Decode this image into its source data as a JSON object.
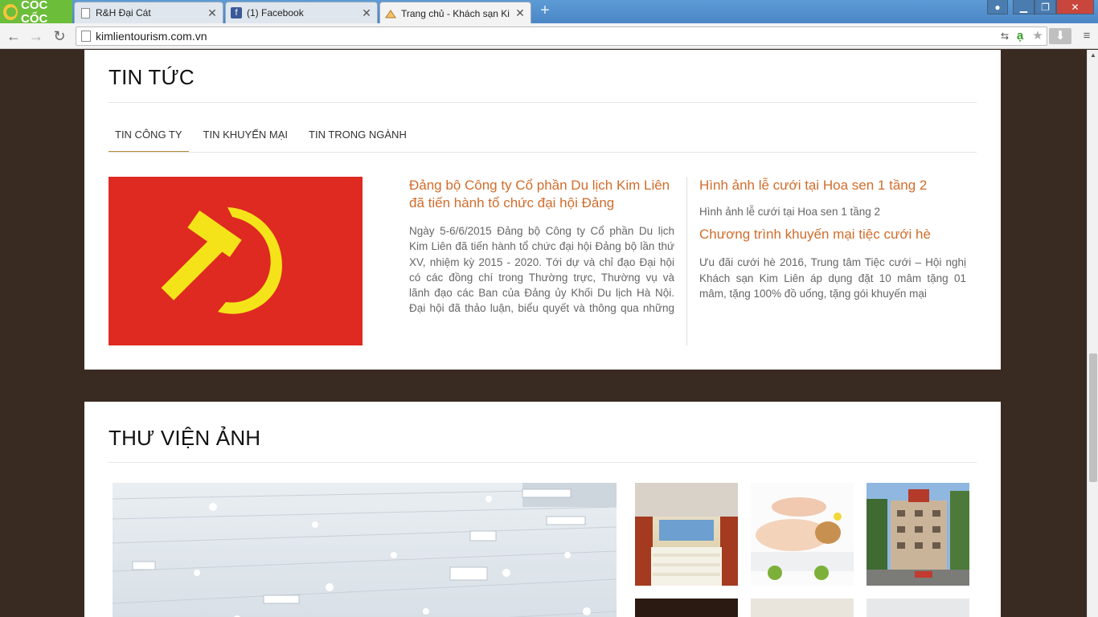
{
  "browser": {
    "brand": "CỐC CỐC",
    "tabs": [
      {
        "title": "R&H Đại Cát",
        "icon": "page-icon"
      },
      {
        "title": "(1) Facebook",
        "icon": "facebook-icon"
      },
      {
        "title": "Trang chủ - Khách sạn Kim",
        "icon": "hotel-favicon"
      }
    ],
    "url": "kimlientourism.com.vn"
  },
  "news": {
    "heading": "TIN TỨC",
    "tabs": [
      "TIN CÔNG TY",
      "TIN KHUYẾN MẠI",
      "TIN TRONG NGÀNH"
    ],
    "active_tab": "TIN CÔNG TY",
    "featured": {
      "title": "Đảng bộ Công ty Cổ phần Du lịch Kim Liên đã tiến hành tổ chức đại hội Đảng",
      "excerpt": "Ngày 5-6/6/2015 Đảng bộ Công ty Cổ phần Du lịch Kim Liên đã tiến hành tổ chức đại hội Đảng bộ lần thứ XV, nhiệm kỳ 2015 - 2020. Tới dự và chỉ đạo Đại hội có các đồng chí trong Thường trực, Thường vụ và lãnh đạo các Ban của Đảng ủy Khối Du lịch Hà Nội. Đại hội đã thảo luận, biểu quyết và thông qua những nội dung quan trọng trong Báo cáo"
    },
    "side": [
      {
        "title": "Hình ảnh lễ cưới tại Hoa sen 1 tầng 2",
        "excerpt": "Hình ảnh lễ cưới tại Hoa sen 1 tầng 2"
      },
      {
        "title": "Chương trình khuyến mại tiệc cưới hè",
        "excerpt": "Ưu đãi cưới hè 2016, Trung tâm Tiệc cưới – Hội nghị Khách sạn Kim Liên áp dụng đặt 10 mâm tặng 01 mâm, tặng 100% đồ uống, tặng gói khuyến mại"
      }
    ]
  },
  "gallery": {
    "heading": "THƯ VIỆN ẢNH"
  },
  "colors": {
    "accent": "#d06d2c",
    "page_bg": "#3a2b22",
    "flag_red": "#de2a21",
    "flag_yellow": "#f5e31a"
  }
}
